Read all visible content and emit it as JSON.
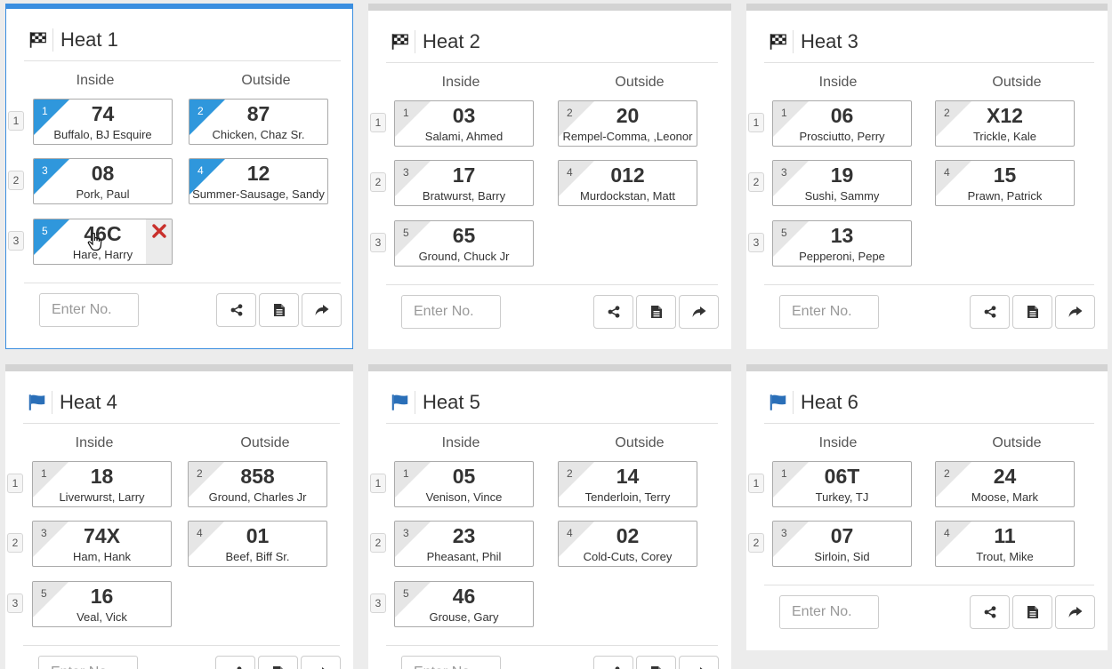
{
  "columns": {
    "inside": "Inside",
    "outside": "Outside"
  },
  "enter_placeholder": "Enter No.",
  "icons": {
    "finished": "checkered-flag-icon",
    "pending": "blue-flag-icon",
    "share": "share-icon",
    "report": "document-icon",
    "next": "forward-arrow-icon",
    "remove": "remove-x-icon",
    "cursor": "hand-pointer-cursor"
  },
  "colors": {
    "accent": "#2f97dc",
    "remove": "#c9302c",
    "flag_blue": "#2a6fb8"
  },
  "heats": [
    {
      "title": "Heat 1",
      "status": "finished",
      "active": true,
      "lane_labels": [
        "1",
        "2",
        "3"
      ],
      "cars": [
        {
          "pos": "1",
          "num": "74",
          "name": "Buffalo, BJ Esquire",
          "highlight": true
        },
        {
          "pos": "2",
          "num": "87",
          "name": "Chicken, Chaz Sr.",
          "highlight": true
        },
        {
          "pos": "3",
          "num": "08",
          "name": "Pork, Paul",
          "highlight": true
        },
        {
          "pos": "4",
          "num": "12",
          "name": "Summer-Sausage, Sandy",
          "highlight": true
        },
        {
          "pos": "5",
          "num": "46C",
          "name": "Hare, Harry",
          "highlight": true,
          "removable": true
        }
      ]
    },
    {
      "title": "Heat 2",
      "status": "finished",
      "lane_labels": [
        "1",
        "2",
        "3"
      ],
      "cars": [
        {
          "pos": "1",
          "num": "03",
          "name": "Salami, Ahmed"
        },
        {
          "pos": "2",
          "num": "20",
          "name": "Rempel-Comma, ,Leonor"
        },
        {
          "pos": "3",
          "num": "17",
          "name": "Bratwurst, Barry"
        },
        {
          "pos": "4",
          "num": "012",
          "name": "Murdockstan, Matt"
        },
        {
          "pos": "5",
          "num": "65",
          "name": "Ground, Chuck Jr"
        }
      ]
    },
    {
      "title": "Heat 3",
      "status": "finished",
      "lane_labels": [
        "1",
        "2",
        "3"
      ],
      "cars": [
        {
          "pos": "1",
          "num": "06",
          "name": "Prosciutto, Perry"
        },
        {
          "pos": "2",
          "num": "X12",
          "name": "Trickle, Kale"
        },
        {
          "pos": "3",
          "num": "19",
          "name": "Sushi, Sammy"
        },
        {
          "pos": "4",
          "num": "15",
          "name": "Prawn, Patrick"
        },
        {
          "pos": "5",
          "num": "13",
          "name": "Pepperoni, Pepe"
        }
      ]
    },
    {
      "title": "Heat 4",
      "status": "pending",
      "lane_labels": [
        "1",
        "2",
        "3"
      ],
      "cars": [
        {
          "pos": "1",
          "num": "18",
          "name": "Liverwurst, Larry"
        },
        {
          "pos": "2",
          "num": "858",
          "name": "Ground, Charles Jr"
        },
        {
          "pos": "3",
          "num": "74X",
          "name": "Ham, Hank"
        },
        {
          "pos": "4",
          "num": "01",
          "name": "Beef, Biff Sr."
        },
        {
          "pos": "5",
          "num": "16",
          "name": "Veal, Vick"
        }
      ]
    },
    {
      "title": "Heat 5",
      "status": "pending",
      "lane_labels": [
        "1",
        "2",
        "3"
      ],
      "cars": [
        {
          "pos": "1",
          "num": "05",
          "name": "Venison, Vince"
        },
        {
          "pos": "2",
          "num": "14",
          "name": "Tenderloin, Terry"
        },
        {
          "pos": "3",
          "num": "23",
          "name": "Pheasant, Phil"
        },
        {
          "pos": "4",
          "num": "02",
          "name": "Cold-Cuts, Corey"
        },
        {
          "pos": "5",
          "num": "46",
          "name": "Grouse, Gary"
        }
      ]
    },
    {
      "title": "Heat 6",
      "status": "pending",
      "lane_labels": [
        "1",
        "2"
      ],
      "cars": [
        {
          "pos": "1",
          "num": "06T",
          "name": "Turkey, TJ"
        },
        {
          "pos": "2",
          "num": "24",
          "name": "Moose, Mark"
        },
        {
          "pos": "3",
          "num": "07",
          "name": "Sirloin, Sid"
        },
        {
          "pos": "4",
          "num": "11",
          "name": "Trout, Mike"
        }
      ]
    }
  ]
}
